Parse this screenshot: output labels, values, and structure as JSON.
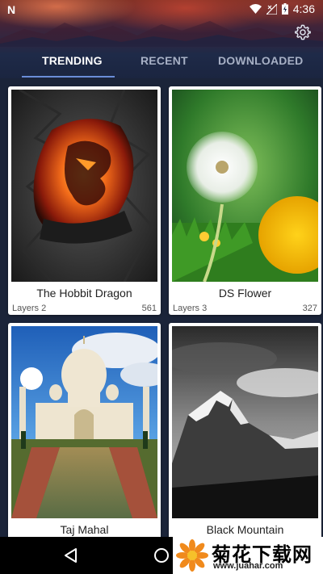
{
  "status_bar": {
    "notification": "N",
    "time": "4:36"
  },
  "tabs": [
    {
      "label": "TRENDING",
      "active": true
    },
    {
      "label": "RECENT",
      "active": false
    },
    {
      "label": "DOWNLOADED",
      "active": false
    }
  ],
  "cards": [
    {
      "title": "The Hobbit Dragon",
      "layers": "Layers 2",
      "count": "561",
      "image": "dragon-in-rock-cave"
    },
    {
      "title": "DS Flower",
      "layers": "Layers 3",
      "count": "327",
      "image": "dandelion-on-green"
    },
    {
      "title": "Taj Mahal",
      "image": "taj-mahal-blue-sky"
    },
    {
      "title": "Black Mountain",
      "image": "black-white-mountain"
    }
  ],
  "navbar": {
    "back_icon": "back-triangle-icon",
    "home_icon": "home-circle-icon"
  },
  "watermark": {
    "chinese": "菊花下载网",
    "url": "www.juahar.com"
  },
  "colors": {
    "tab_active": "#ffffff",
    "tab_inactive": "#a7b0c5",
    "tab_indicator": "#6a8dd8",
    "background": "#1b2439"
  }
}
